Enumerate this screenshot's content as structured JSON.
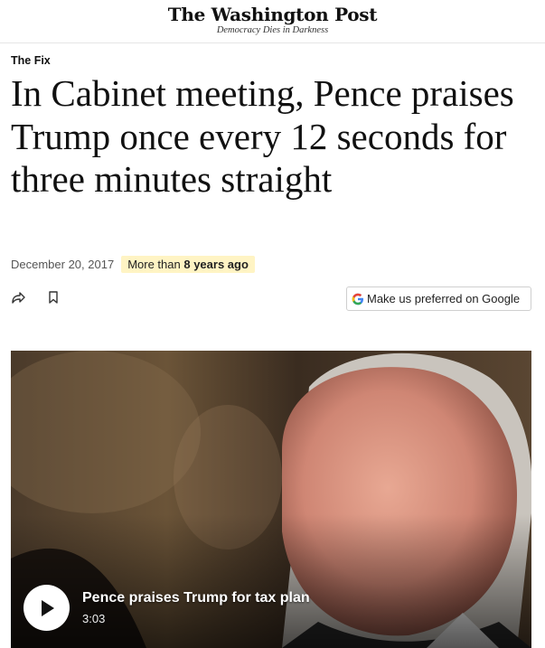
{
  "masthead": {
    "logo_text": "The Washington Post",
    "tagline": "Democracy Dies in Darkness"
  },
  "article": {
    "kicker": "The Fix",
    "headline": "In Cabinet meeting, Pence praises Trump once every 12 seconds for three minutes straight",
    "date": "December 20, 2017",
    "age_prefix": "More than",
    "age_value": "8 years ago"
  },
  "actions": {
    "share_icon": "share-icon",
    "bookmark_icon": "bookmark-icon",
    "preferred_label": "Make us preferred on Google",
    "google_icon": "google-g-icon"
  },
  "video": {
    "title": "Pence praises Trump for tax plan",
    "duration": "3:03",
    "play_icon": "play-icon"
  },
  "colors": {
    "badge_bg": "#fff4c4",
    "text": "#111111",
    "muted": "#555555"
  }
}
